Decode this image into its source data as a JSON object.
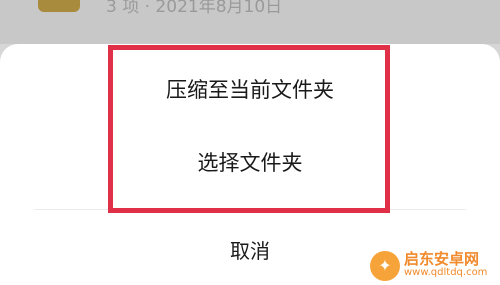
{
  "background": {
    "meta_text": "3 项 · 2021年8月10日"
  },
  "sheet": {
    "options": [
      {
        "label": "压缩至当前文件夹"
      },
      {
        "label": "选择文件夹"
      }
    ],
    "cancel_label": "取消"
  },
  "watermark": {
    "title": "启东安卓网",
    "url": "www.qdltdq.com"
  },
  "colors": {
    "highlight": "#e03048",
    "watermark": "#f08a2c"
  }
}
